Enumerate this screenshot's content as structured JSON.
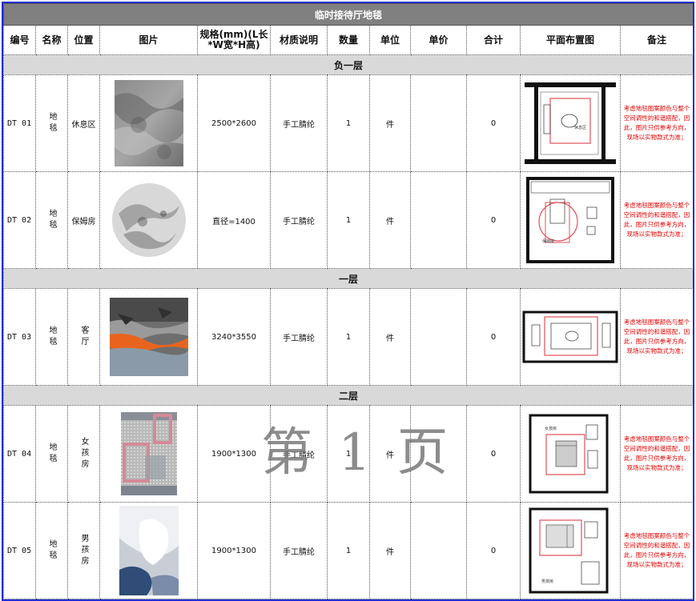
{
  "sheet": {
    "title": "临时接待厅地毯",
    "watermark": "第 1 页"
  },
  "headers": {
    "code": "编号",
    "name": "名称",
    "location": "位置",
    "picture": "图片",
    "spec": "规格(mm)(L长*W宽*H高)",
    "material": "材质说明",
    "qty": "数量",
    "unit": "单位",
    "price": "单价",
    "total": "合计",
    "plan": "平面布置图",
    "remark": "备注"
  },
  "sections": [
    {
      "label": "负一层"
    },
    {
      "label": "一层"
    },
    {
      "label": "二层"
    }
  ],
  "rows": [
    {
      "code": "DT 01",
      "name": "地毯",
      "location": "休息区",
      "spec": "2500*2600",
      "material": "手工腈纶",
      "qty": "1",
      "unit": "件",
      "price": "",
      "total": "0",
      "room_label": "休息区",
      "remark": "考虑地毯图案颜色与整个空间调性的和谐搭配，因此，图片只供参考方向，现场以实物款式为准；"
    },
    {
      "code": "DT 02",
      "name": "地毯",
      "location": "保姆房",
      "spec": "直径=1400",
      "material": "手工腈纶",
      "qty": "1",
      "unit": "件",
      "price": "",
      "total": "0",
      "room_label": "保姆房",
      "remark": "考虑地毯图案颜色与整个空间调性的和谐搭配，因此，图片只供参考方向，现场以实物款式为准；"
    },
    {
      "code": "DT 03",
      "name": "地毯",
      "location": "客厅",
      "spec": "3240*3550",
      "material": "手工腈纶",
      "qty": "1",
      "unit": "件",
      "price": "",
      "total": "0",
      "room_label": "",
      "remark": "考虑地毯图案颜色与整个空间调性的和谐搭配，因此，图片只供参考方向，现场以实物款式为准；"
    },
    {
      "code": "DT 04",
      "name": "地毯",
      "location": "女孩房",
      "spec": "1900*1300",
      "material": "手工腈纶",
      "qty": "1",
      "unit": "件",
      "price": "",
      "total": "0",
      "room_label": "女孩房",
      "remark": "考虑地毯图案颜色与整个空间调性的和谐搭配，因此，图片只供参考方向，现场以实物款式为准；"
    },
    {
      "code": "DT 05",
      "name": "地毯",
      "location": "男孩房",
      "spec": "1900*1300",
      "material": "手工腈纶",
      "qty": "1",
      "unit": "件",
      "price": "",
      "total": "0",
      "room_label": "男孩房",
      "remark": "考虑地毯图案颜色与整个空间调性的和谐搭配，因此，图片只供参考方向，现场以实物款式为准；"
    }
  ],
  "colors": {
    "border": "#1f2fd6",
    "title_bg": "#808080",
    "section_bg": "#d9d9d9",
    "remark_text": "#e00000",
    "plan_highlight": "#e0505a"
  }
}
